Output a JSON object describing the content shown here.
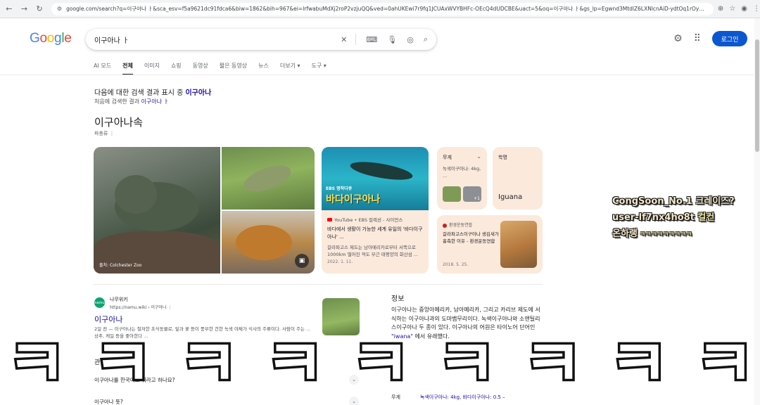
{
  "browser": {
    "url": "google.com/search?q=이구아나 ㅏ&sca_esv=f5a9621dc91fdca6&biw=1862&bih=967&ei=lrfwabuMdXj2roP2vzjuQQ&ved=0ahUKEwi7r9fq1JCUAxWVYBHFc-OEcQ4dUDCBE&uact=5&oq=이구아나 ㅏ&gs_lp=Egwnd3MtdlZ6LXNlcnAiD-ydtOq1rOyVhOuCmOOF..."
  },
  "logo": "Google",
  "search": {
    "query": "이구아나 ㅏ"
  },
  "header": {
    "login_label": "로그인"
  },
  "tabs": [
    "AI 모드",
    "전체",
    "이미지",
    "쇼핑",
    "동영상",
    "짧은 동영상",
    "뉴스",
    "더보기 ▾",
    "도구 ▾"
  ],
  "correction": {
    "showing_prefix": "다음에 대한 검색 결과 표시 중 ",
    "showing_link": "이구아나",
    "instead_prefix": "처음에 검색한 결과 ",
    "instead_link": "이구아나 ㅏ"
  },
  "knowledge": {
    "title": "이구아나속",
    "subtitle": "파충류  ⋮",
    "image_caption": "출처: Colchester Zoo"
  },
  "video": {
    "thumb_small": "EBS 명작다큐",
    "thumb_big": "바다이구아나",
    "source": "YouTube • EBS 컬렉션 - 사이언스",
    "title": "바다에서 생활이 가능한 세계 유일의 '바다이구아나' ...",
    "desc": "갈라파고스 제도는 남아메리카로부터 서쪽으로 1000km 떨어진 적도 부근 태평양의 화산섬 ...",
    "date": "2022. 1. 11."
  },
  "cards": {
    "weight_label": "무게",
    "weight_text": "녹색이구아나: 4kg, ...",
    "weight_count": "+1",
    "sci_label": "학명",
    "sci_value": "Iguana",
    "article_source": "환경운동연합",
    "article_title": "갈라파고스이구아나 생김새가 흉측한 이유 - 환경운동연합",
    "article_date": "2018. 5. 25."
  },
  "result": {
    "site": "나무위키",
    "favicon": "namu",
    "url": "https://namu.wiki › 이구아나  ⋮",
    "title": "이구아나",
    "snippet": "2일 전 — 이구아나는 철저한 초식동물로, 잎과 꽃 등이 풍부한 건한 녹색 야채가 식사의 주류이다. 사람이 주는 ... 상추, 케일 등을 좋아한다 ..."
  },
  "paa": {
    "heading": "관련 질문",
    "q1": "이구아나를 한국어로 뭐라고 하나요?",
    "q2": "이구아나 뜻?"
  },
  "info": {
    "heading": "정보",
    "text_a": "이구아나는 중앙아메리카, 남아메리카, 그리고 카리브 제도에 서식하는 이구아나과의 도마뱀무리이다. 녹색이구아나와 소앤틸리스이구아나 두 종이 있다. 이구아나의 어원은 타이노어 단어인 ",
    "text_link": "\"iwana\"",
    "text_b": " 에서 유래했다.",
    "row_label": "무게",
    "row_value": "녹색이구아나: 4kg, 바다이구아나: 0.5 –"
  },
  "overlay": {
    "line1": "CongSoon_No.1 크레이즈?",
    "line2_user": "user-lf7nx4ho8t",
    "line2_msg": " 컬컨",
    "line3_user": "온하랭",
    "line3_msg": " ㅋㅋㅋㅋㅋㅋㅋㅋㅋ",
    "kk": [
      "ㅋ",
      "ㅋ",
      "ㅋ",
      "ㅋ",
      "ㅋ",
      "ㅋ",
      "ㅋ",
      "ㅋ",
      "ㅋ"
    ]
  },
  "colors": {
    "link": "#1a0dab",
    "accent": "#0b57d0",
    "card_bg": "#fbe9dc"
  }
}
